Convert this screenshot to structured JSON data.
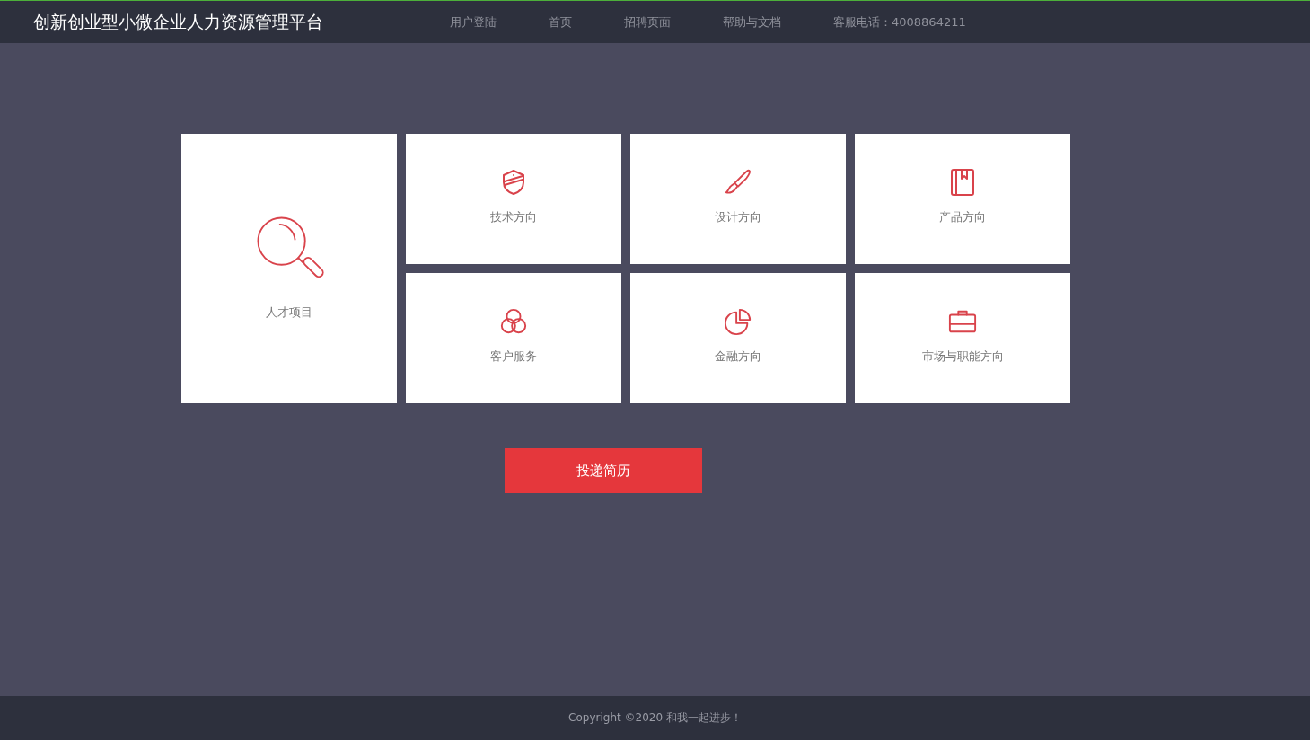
{
  "header": {
    "title": "创新创业型小微企业人力资源管理平台",
    "nav": [
      {
        "label": "用户登陆"
      },
      {
        "label": "首页"
      },
      {
        "label": "招聘页面"
      },
      {
        "label": "帮助与文档"
      },
      {
        "label": "客服电话：4008864211"
      }
    ]
  },
  "tiles": [
    {
      "label": "人才项目",
      "kind": "large"
    },
    {
      "label": "技术方向",
      "kind": "small"
    },
    {
      "label": "设计方向",
      "kind": "small"
    },
    {
      "label": "产品方向",
      "kind": "small"
    },
    {
      "label": "客户服务",
      "kind": "small"
    },
    {
      "label": "金融方向",
      "kind": "small"
    },
    {
      "label": "市场与职能方向",
      "kind": "small"
    }
  ],
  "submit_button": "投递简历",
  "footer": "Copyright ©2020 和我一起进步！"
}
